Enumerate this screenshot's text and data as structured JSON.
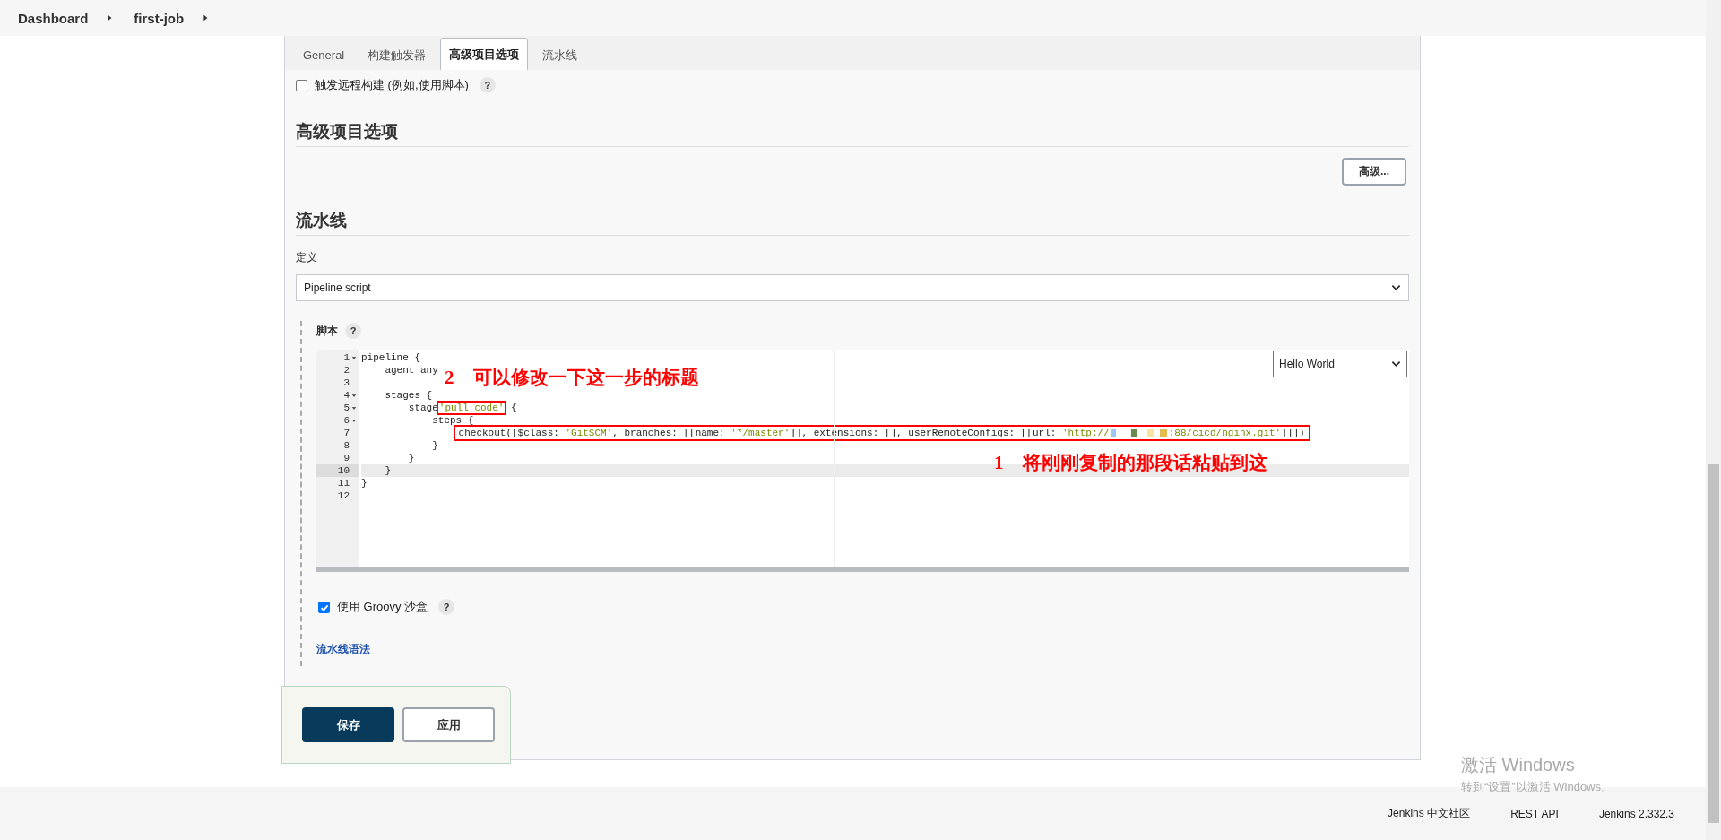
{
  "breadcrumb": [
    {
      "label": "Dashboard"
    },
    {
      "label": "first-job"
    }
  ],
  "tabs": [
    {
      "label": "General",
      "selected": false
    },
    {
      "label": "构建触发器",
      "selected": false
    },
    {
      "label": "高级项目选项",
      "selected": true
    },
    {
      "label": "流水线",
      "selected": false
    }
  ],
  "options": [
    {
      "label": "触发远程构建 (例如,使用脚本)",
      "checked": false,
      "help": "?"
    }
  ],
  "advanced_section": {
    "title": "高级项目选项",
    "button": "高级..."
  },
  "pipeline_section": {
    "title": "流水线",
    "definition_label": "定义",
    "definition_value": "Pipeline script",
    "script_label": "脚本",
    "script_help": "?",
    "template": "Hello World",
    "lines": [
      {
        "number": "1",
        "fold": true,
        "selected": false,
        "boxed": false,
        "tokens": [
          {
            "kind": "plain",
            "text": "pipeline {",
            "boxed": false
          }
        ]
      },
      {
        "number": "2",
        "fold": false,
        "selected": false,
        "boxed": false,
        "tokens": [
          {
            "kind": "plain",
            "text": "agent any",
            "boxed": false
          }
        ]
      },
      {
        "number": "3",
        "fold": false,
        "selected": false,
        "boxed": false
      },
      {
        "number": "4",
        "fold": true,
        "selected": false,
        "boxed": false,
        "tokens": [
          {
            "kind": "plain",
            "text": "stages {",
            "boxed": false
          }
        ]
      },
      {
        "number": "5",
        "fold": true,
        "selected": false,
        "boxed": false,
        "tokens": [
          {
            "kind": "plain",
            "text": "stage",
            "boxed": false
          },
          {
            "kind": "string",
            "text": "'pull code'",
            "boxed": true
          },
          {
            "kind": "plain",
            "text": " {",
            "boxed": false
          }
        ]
      },
      {
        "number": "6",
        "fold": true,
        "selected": false,
        "boxed": false,
        "tokens": [
          {
            "kind": "plain",
            "text": "steps {",
            "boxed": false
          }
        ]
      },
      {
        "number": "7",
        "fold": false,
        "selected": false,
        "boxed": true,
        "tokens": [
          {
            "kind": "plain",
            "text": "checkout([$class: ",
            "boxed": false
          },
          {
            "kind": "string",
            "text": "'GitSCM'",
            "boxed": false
          },
          {
            "kind": "plain",
            "text": ", branches: [[name: ",
            "boxed": false
          },
          {
            "kind": "string",
            "text": "'*/master'",
            "boxed": false
          },
          {
            "kind": "plain",
            "text": "]], extensions: [], userRemoteConfigs: [[url: ",
            "boxed": false
          },
          {
            "kind": "string",
            "text": "'http://",
            "boxed": false
          },
          {
            "kind": "redacted"
          },
          {
            "kind": "string",
            "text": ":88/cicd/nginx.git'",
            "boxed": false
          },
          {
            "kind": "plain",
            "text": "]]])",
            "boxed": false
          }
        ]
      },
      {
        "number": "8",
        "fold": false,
        "selected": false,
        "boxed": false,
        "tokens": [
          {
            "kind": "plain",
            "text": "}",
            "boxed": false
          }
        ]
      },
      {
        "number": "9",
        "fold": false,
        "selected": false,
        "boxed": false,
        "tokens": [
          {
            "kind": "plain",
            "text": "}",
            "boxed": false
          }
        ]
      },
      {
        "number": "10",
        "fold": false,
        "selected": true,
        "boxed": false,
        "tokens": [
          {
            "kind": "plain",
            "text": "}",
            "boxed": false
          }
        ]
      },
      {
        "number": "11",
        "fold": false,
        "selected": false,
        "boxed": false,
        "tokens": [
          {
            "kind": "plain",
            "text": "}",
            "boxed": false
          }
        ]
      },
      {
        "number": "12",
        "fold": false,
        "selected": false,
        "boxed": false
      }
    ],
    "annotations": [
      {
        "number": "2",
        "text": "可以修改一下这一步的标题"
      },
      {
        "number": "1",
        "text": "将刚刚复制的那段话粘贴到这"
      }
    ],
    "sandbox": {
      "label": "使用 Groovy 沙盒",
      "checked": true,
      "help": "?"
    },
    "syntax_link": "流水线语法"
  },
  "actions": [
    {
      "label": "保存",
      "kind": "primary"
    },
    {
      "label": "应用",
      "kind": "secondary"
    }
  ],
  "footer": {
    "links": [
      "Jenkins 中文社区",
      "REST API",
      "Jenkins 2.332.3"
    ]
  },
  "os_notice": {
    "title": "激活 Windows",
    "text": "转到“设置”以激活 Windows。"
  }
}
